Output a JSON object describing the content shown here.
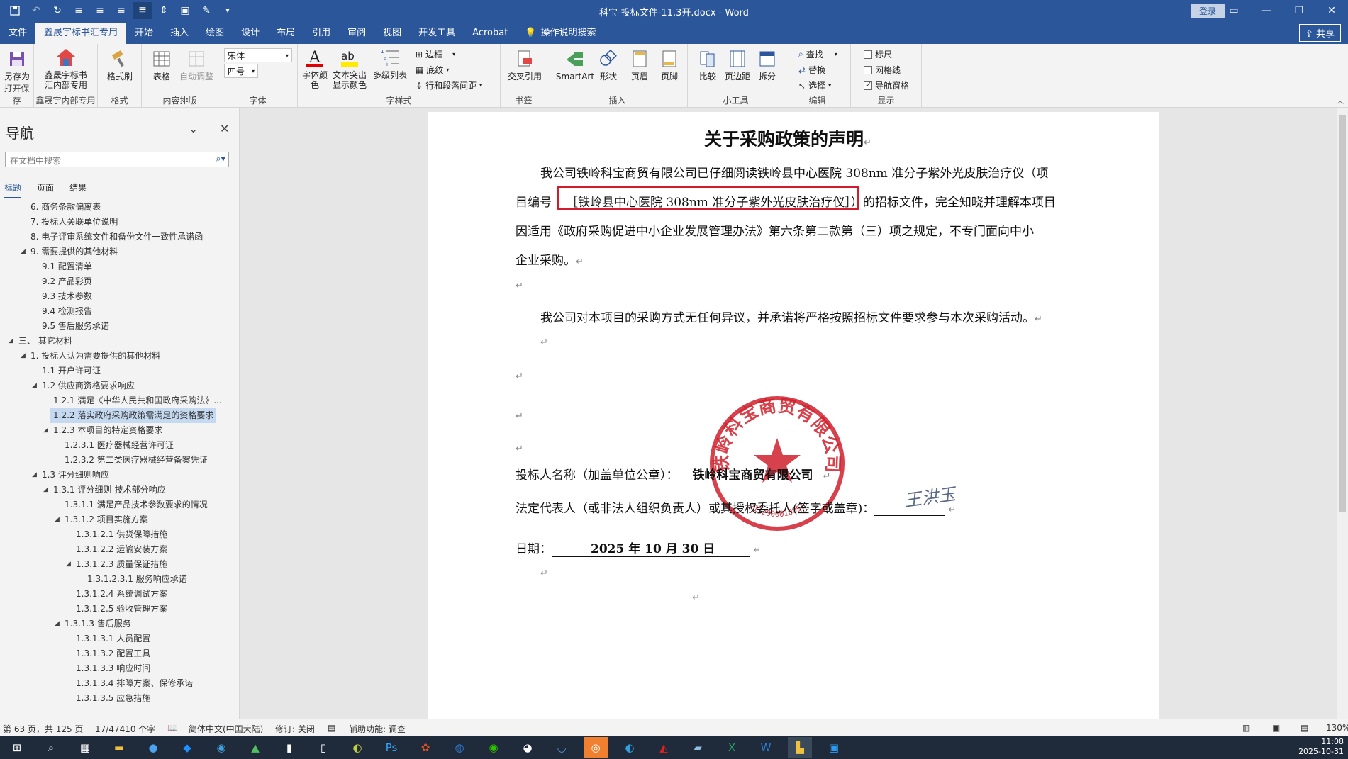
{
  "window": {
    "title": "科宝-投标文件-11.3开.docx  -  Word",
    "login_label": "登录"
  },
  "tabs": [
    {
      "label": "文件"
    },
    {
      "label": "鑫晟宇标书汇专用",
      "active": true
    },
    {
      "label": "开始"
    },
    {
      "label": "插入"
    },
    {
      "label": "绘图"
    },
    {
      "label": "设计"
    },
    {
      "label": "布局"
    },
    {
      "label": "引用"
    },
    {
      "label": "审阅"
    },
    {
      "label": "视图"
    },
    {
      "label": "开发工具"
    },
    {
      "label": "Acrobat"
    }
  ],
  "tell_me": "操作说明搜索",
  "share_label": "共享",
  "ribbon": {
    "save_as": "另存为",
    "open_save_group": "打开保存",
    "xsy_btn": "鑫晟宇标书汇内部专用",
    "xsy_group": "鑫晟宇内部专用",
    "format_painter": "格式刷",
    "format_group": "格式",
    "table": "表格",
    "auto_adjust": "自动调整",
    "content_layout_group": "内容排版",
    "font_name": "宋体",
    "font_size": "四号",
    "font_group": "字体",
    "font_color": "字体颜色",
    "highlight": "文本突出显示颜色",
    "multilevel": "多级列表",
    "border": "边框",
    "shading": "底纹",
    "line_spacing": "行和段落间距",
    "style_group": "字样式",
    "cross_ref": "交叉引用",
    "bookmark_group": "书签",
    "smartart": "SmartArt",
    "shapes": "形状",
    "header": "页眉",
    "footer": "页脚",
    "insert_group": "插入",
    "compare": "比较",
    "margins": "页边距",
    "split": "拆分",
    "tools_group": "小工具",
    "find": "查找",
    "replace": "替换",
    "select": "选择",
    "edit_group": "编辑",
    "ruler": "标尺",
    "gridlines": "网格线",
    "nav_pane": "导航窗格",
    "show_group": "显示",
    "ruler_checked": false,
    "gridlines_checked": false,
    "nav_pane_checked": true
  },
  "nav": {
    "title": "导航",
    "search_placeholder": "在文档中搜索",
    "tabs": [
      "标题",
      "页面",
      "结果"
    ],
    "items": [
      {
        "label": "6. 商务条款偏离表",
        "level": 2,
        "arrow": ""
      },
      {
        "label": "7. 投标人关联单位说明",
        "level": 2,
        "arrow": ""
      },
      {
        "label": "8. 电子评审系统文件和备份文件一致性承诺函",
        "level": 2,
        "arrow": ""
      },
      {
        "label": "9. 需要提供的其他材料",
        "level": 2,
        "arrow": "◢"
      },
      {
        "label": "9.1 配置清单",
        "level": 3,
        "arrow": ""
      },
      {
        "label": "9.2 产品彩页",
        "level": 3,
        "arrow": ""
      },
      {
        "label": "9.3 技术参数",
        "level": 3,
        "arrow": ""
      },
      {
        "label": "9.4 检测报告",
        "level": 3,
        "arrow": ""
      },
      {
        "label": "9.5 售后服务承诺",
        "level": 3,
        "arrow": ""
      },
      {
        "label": "三、 其它材料",
        "level": 1,
        "arrow": "◢"
      },
      {
        "label": "1. 投标人认为需要提供的其他材料",
        "level": 2,
        "arrow": "◢"
      },
      {
        "label": "1.1 开户许可证",
        "level": 3,
        "arrow": ""
      },
      {
        "label": "1.2 供应商资格要求响应",
        "level": 3,
        "arrow": "◢"
      },
      {
        "label": "1.2.1 满足《中华人民共和国政府采购法》...",
        "level": 4,
        "arrow": ""
      },
      {
        "label": "1.2.2 落实政府采购政策需满足的资格要求",
        "level": 4,
        "arrow": "",
        "selected": true
      },
      {
        "label": "1.2.3 本项目的特定资格要求",
        "level": 4,
        "arrow": "◢"
      },
      {
        "label": "1.2.3.1 医疗器械经营许可证",
        "level": 5,
        "arrow": ""
      },
      {
        "label": "1.2.3.2 第二类医疗器械经营备案凭证",
        "level": 5,
        "arrow": ""
      },
      {
        "label": "1.3 评分细则响应",
        "level": 3,
        "arrow": "◢"
      },
      {
        "label": "1.3.1 评分细则-技术部分响应",
        "level": 4,
        "arrow": "◢"
      },
      {
        "label": "1.3.1.1 满足产品技术参数要求的情况",
        "level": 5,
        "arrow": ""
      },
      {
        "label": "1.3.1.2 项目实施方案",
        "level": 5,
        "arrow": "◢"
      },
      {
        "label": "1.3.1.2.1 供货保障措施",
        "level": 6,
        "arrow": ""
      },
      {
        "label": "1.3.1.2.2 运输安装方案",
        "level": 6,
        "arrow": ""
      },
      {
        "label": "1.3.1.2.3 质量保证措施",
        "level": 6,
        "arrow": "◢"
      },
      {
        "label": "1.3.1.2.3.1 服务响应承诺",
        "level": 7,
        "arrow": ""
      },
      {
        "label": "1.3.1.2.4 系统调试方案",
        "level": 6,
        "arrow": ""
      },
      {
        "label": "1.3.1.2.5 验收管理方案",
        "level": 6,
        "arrow": ""
      },
      {
        "label": "1.3.1.3 售后服务",
        "level": 5,
        "arrow": "◢"
      },
      {
        "label": "1.3.1.3.1 人员配置",
        "level": 6,
        "arrow": ""
      },
      {
        "label": "1.3.1.3.2 配置工具",
        "level": 6,
        "arrow": ""
      },
      {
        "label": "1.3.1.3.3 响应时间",
        "level": 6,
        "arrow": ""
      },
      {
        "label": "1.3.1.3.4 排障方案、保修承诺",
        "level": 6,
        "arrow": ""
      },
      {
        "label": "1.3.1.3.5 应急措施",
        "level": 6,
        "arrow": ""
      }
    ]
  },
  "doc": {
    "title": "关于采购政策的声明",
    "p1_line1": "我公司铁岭科宝商贸有限公司已仔细阅读铁岭县中心医院 308nm 准分子紫外光皮肤治疗仪（项",
    "p1_line2_a": "目编号",
    "p1_line2_b": "［铁岭县中心医院 308nm 准分子紫外光皮肤治疗仪］）的招标文件，完全知晓并理解本项目",
    "p1_line3": "因适用《政府采购促进中小企业发展管理办法》第六条第二款第（三）项之规定，不专门面向中小",
    "p1_line4": "企业采购。",
    "p2": "我公司对本项目的采购方式无任何异议，并承诺将严格按照招标文件要求参与本次采购活动。",
    "bidder_label": "投标人名称（加盖单位公章）：",
    "bidder_value": "铁岭科宝商贸有限公司",
    "rep_label": "法定代表人（或非法人组织负责人）或其授权委托人(签字或盖章)：",
    "signature": "王洪玉",
    "date_label": "日期：",
    "date_value": "2025 年 10 月 30 日",
    "seal_text": "铁岭科宝商贸有限公司",
    "seal_number": "2112000010051"
  },
  "status": {
    "page": "第 63 页，共 125 页",
    "words": "17/47410 个字",
    "lang": "简体中文(中国大陆)",
    "track": "修订: 关闭",
    "accessibility": "辅助功能: 调查",
    "zoom": "130%"
  },
  "clock": {
    "time": "11:08",
    "date": "2025-10-31"
  },
  "colors": {
    "word_blue": "#2b579a",
    "seal_red": "#d0202c",
    "highlight_box": "#d01c2c"
  }
}
